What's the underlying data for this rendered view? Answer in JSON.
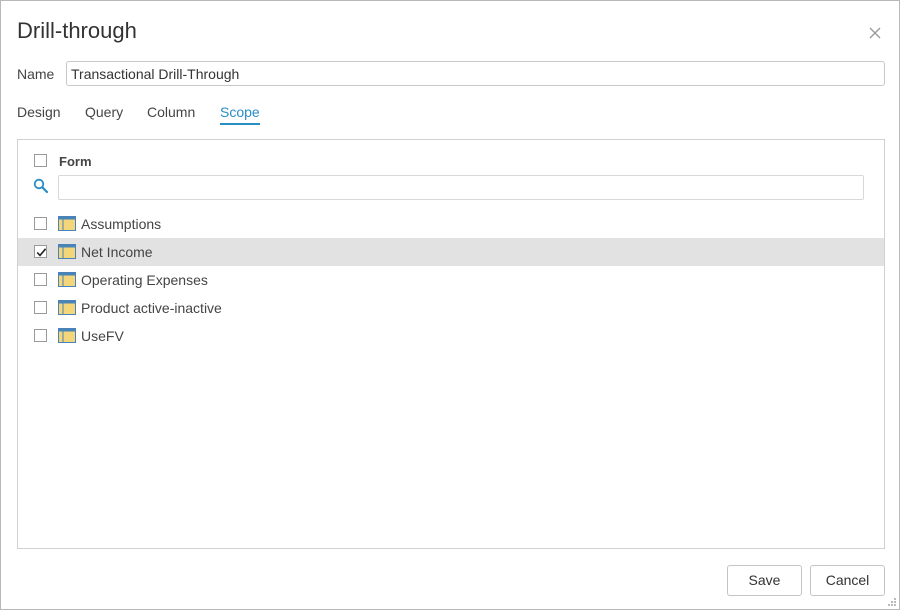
{
  "dialog": {
    "title": "Drill-through",
    "close_icon": "close-icon"
  },
  "name": {
    "label": "Name",
    "value": "Transactional Drill-Through"
  },
  "tabs": [
    {
      "label": "Design",
      "active": false
    },
    {
      "label": "Query",
      "active": false
    },
    {
      "label": "Column",
      "active": false
    },
    {
      "label": "Scope",
      "active": true
    }
  ],
  "scope": {
    "header_label": "Form",
    "header_checked": false,
    "search_placeholder": "",
    "search_icon": "search-icon",
    "items": [
      {
        "label": "Assumptions",
        "checked": false,
        "selected": false,
        "icon": "form-icon"
      },
      {
        "label": "Net Income",
        "checked": true,
        "selected": true,
        "icon": "form-icon"
      },
      {
        "label": "Operating Expenses",
        "checked": false,
        "selected": false,
        "icon": "form-icon"
      },
      {
        "label": "Product active-inactive",
        "checked": false,
        "selected": false,
        "icon": "form-icon"
      },
      {
        "label": "UseFV",
        "checked": false,
        "selected": false,
        "icon": "form-icon"
      }
    ]
  },
  "buttons": {
    "save": "Save",
    "cancel": "Cancel"
  },
  "colors": {
    "accent": "#2a8dc5",
    "selected_row": "#e2e2e2",
    "form_icon_yellow": "#f3d67a",
    "form_icon_blue": "#4a83b8"
  }
}
